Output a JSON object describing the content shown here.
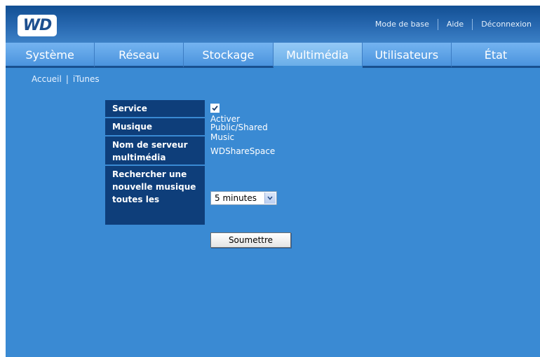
{
  "header": {
    "logo": "WD",
    "links": [
      "Mode de base",
      "Aide",
      "Déconnexion"
    ]
  },
  "tabs": [
    "Système",
    "Réseau",
    "Stockage",
    "Multimédia",
    "Utilisateurs",
    "État"
  ],
  "active_tab": "Multimédia",
  "breadcrumb": [
    "Accueil",
    "iTunes"
  ],
  "form": {
    "service_label": "Service",
    "service_checkbox_label": "Activer",
    "service_checked": true,
    "music_label": "Musique",
    "music_value": "Public/Shared Music",
    "server_label": "Nom de serveur multimédia",
    "server_value": "WDShareSpace",
    "rescan_label": "Rechercher une nouvelle musique toutes les",
    "rescan_value": "5 minutes",
    "submit_label": "Soumettre"
  },
  "colors": {
    "background": "#3a8ad3",
    "label_bg": "#0e3e7a"
  }
}
